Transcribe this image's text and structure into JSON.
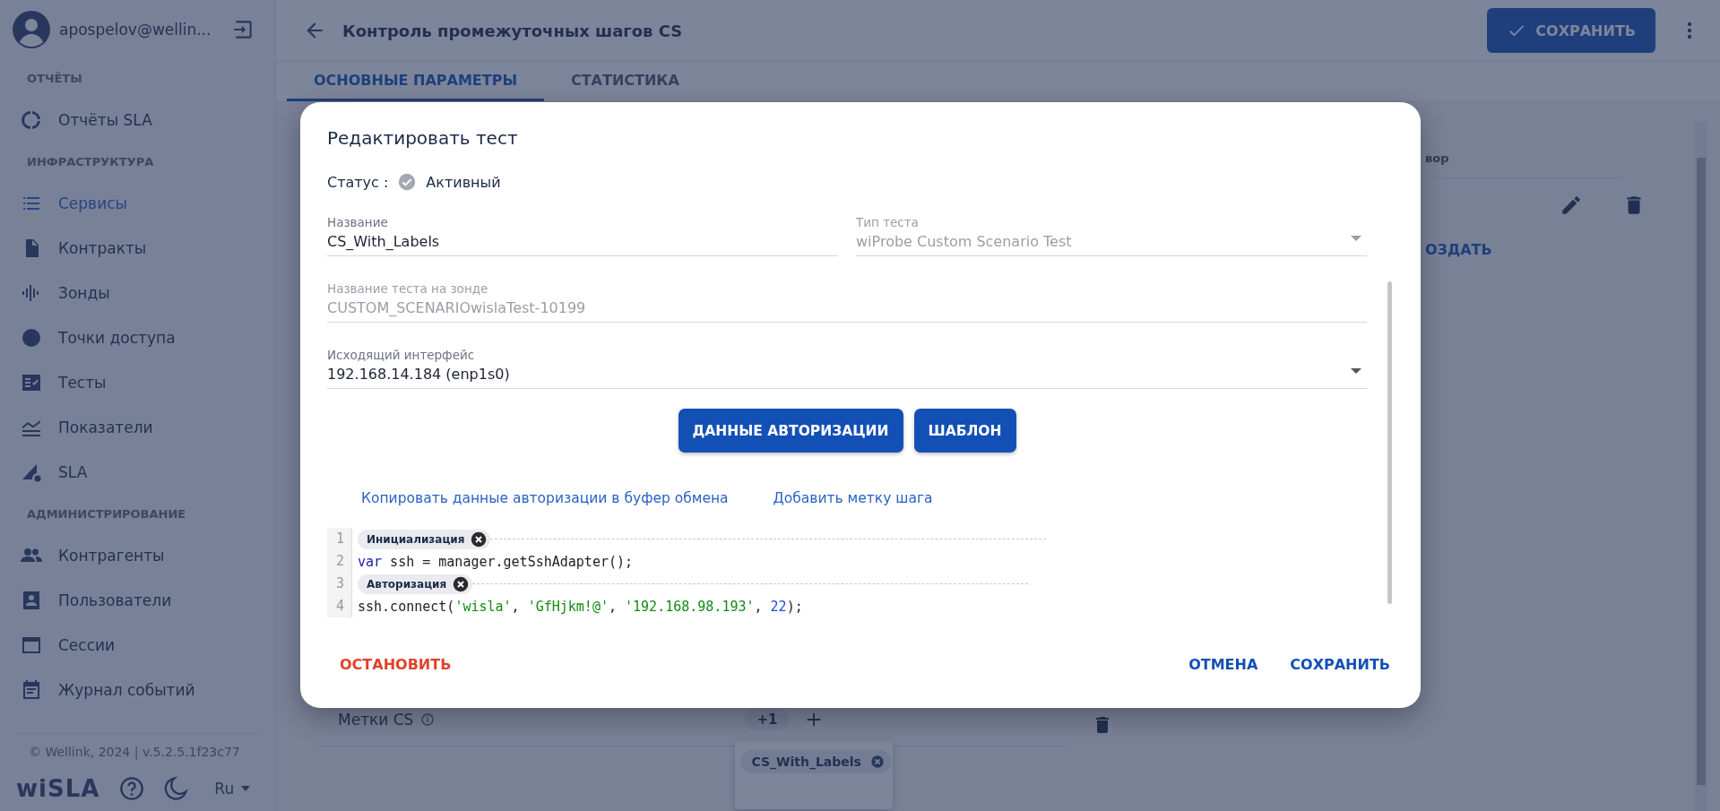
{
  "sidebar": {
    "user": {
      "name": "apospelov@wellin..."
    },
    "sections": [
      {
        "title": "ОТЧЁТЫ",
        "items": [
          {
            "label": "Отчёты SLA",
            "selected": false
          }
        ]
      },
      {
        "title": "ИНФРАСТРУКТУРА",
        "items": [
          {
            "label": "Сервисы",
            "selected": true
          },
          {
            "label": "Контракты",
            "selected": false
          },
          {
            "label": "Зонды",
            "selected": false
          },
          {
            "label": "Точки доступа",
            "selected": false
          },
          {
            "label": "Тесты",
            "selected": false
          },
          {
            "label": "Показатели",
            "selected": false
          },
          {
            "label": "SLA",
            "selected": false
          }
        ]
      },
      {
        "title": "АДМИНИСТРИРОВАНИЕ",
        "items": [
          {
            "label": "Контрагенты",
            "selected": false
          },
          {
            "label": "Пользователи",
            "selected": false
          },
          {
            "label": "Сессии",
            "selected": false
          },
          {
            "label": "Журнал событий",
            "selected": false
          }
        ]
      }
    ],
    "footer": {
      "copyright": "© Wellink, 2024 | v.5.2.5.1f23c77",
      "logo": "wiSLA",
      "language": "Ru"
    }
  },
  "header": {
    "title": "Контроль промежуточных шагов CS",
    "save_button": "СОХРАНИТЬ"
  },
  "tabs": [
    {
      "label": "ОСНОВНЫЕ ПАРАМЕТРЫ",
      "selected": true
    },
    {
      "label": "СТАТИСТИКА",
      "selected": false
    }
  ],
  "right_panel": {
    "column_header": "вор",
    "create_button": "ОЗДАТЬ"
  },
  "labels_row": {
    "label": "Метки CS",
    "count": "+1",
    "menu_chips": [
      "CS_With_Labels"
    ]
  },
  "dialog": {
    "title": "Редактировать тест",
    "status_label": "Статус :",
    "status_value": "Активный",
    "fields": [
      {
        "label": "Название",
        "value": "CS_With_Labels",
        "kind": "text",
        "disabled": false
      },
      {
        "label": "Тип теста",
        "value": "wiProbe Custom Scenario Test",
        "kind": "select",
        "disabled": true
      },
      {
        "label": "Название теста на зонде",
        "value": "CUSTOM_SCENARIOwislaTest-10199",
        "kind": "text",
        "disabled": true
      },
      {
        "label": "Исходящий интерфейс",
        "value": "192.168.14.184 (enp1s0)",
        "kind": "select",
        "disabled": false
      }
    ],
    "buttons": [
      "ДАННЫЕ АВТОРИЗАЦИИ",
      "ШАБЛОН"
    ],
    "links": [
      "Копировать данные авторизации в буфер обмена",
      "Добавить метку шага"
    ],
    "code": [
      {
        "number": "1",
        "kind": "label",
        "text": "Инициализация"
      },
      {
        "number": "2",
        "kind": "code",
        "tokens": [
          {
            "kind": "keyword",
            "text": "var"
          },
          {
            "kind": "plain",
            "text": " ssh = manager.getSshAdapter();"
          }
        ]
      },
      {
        "number": "3",
        "kind": "label",
        "text": "Авторизация"
      },
      {
        "number": "4",
        "kind": "code",
        "tokens": [
          {
            "kind": "plain",
            "text": "ssh.connect("
          },
          {
            "kind": "string",
            "text": "'wisla'"
          },
          {
            "kind": "plain",
            "text": ", "
          },
          {
            "kind": "string",
            "text": "'GfHjkm!@'"
          },
          {
            "kind": "plain",
            "text": ", "
          },
          {
            "kind": "string",
            "text": "'192.168.98.193'"
          },
          {
            "kind": "plain",
            "text": ", "
          },
          {
            "kind": "number",
            "text": "22"
          },
          {
            "kind": "plain",
            "text": ");"
          }
        ]
      }
    ],
    "stop_button": "ОСТАНОВИТЬ",
    "cancel_button": "ОТМЕНА",
    "save_button": "СОХРАНИТЬ"
  }
}
